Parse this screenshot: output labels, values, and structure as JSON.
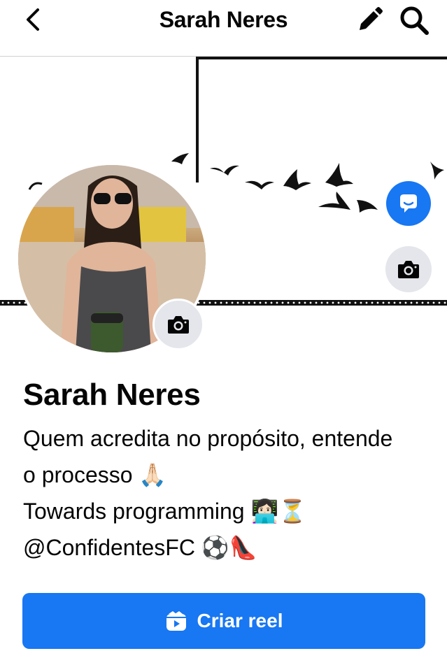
{
  "header": {
    "title": "Sarah Neres",
    "icons": [
      "back-arrow-icon",
      "pencil-icon",
      "search-icon"
    ]
  },
  "profile": {
    "name": "Sarah Neres",
    "bio_lines": [
      "Quem acredita no propósito, entende",
      "o processo 🙏🏻",
      "Towards programming 👩🏻‍💻⏳",
      "@ConfidentesFC ⚽👠"
    ]
  },
  "actions": {
    "create_reel_label": "Criar reel"
  },
  "colors": {
    "accent": "#1877f2",
    "button_gray": "#e4e6eb",
    "text": "#050505"
  }
}
